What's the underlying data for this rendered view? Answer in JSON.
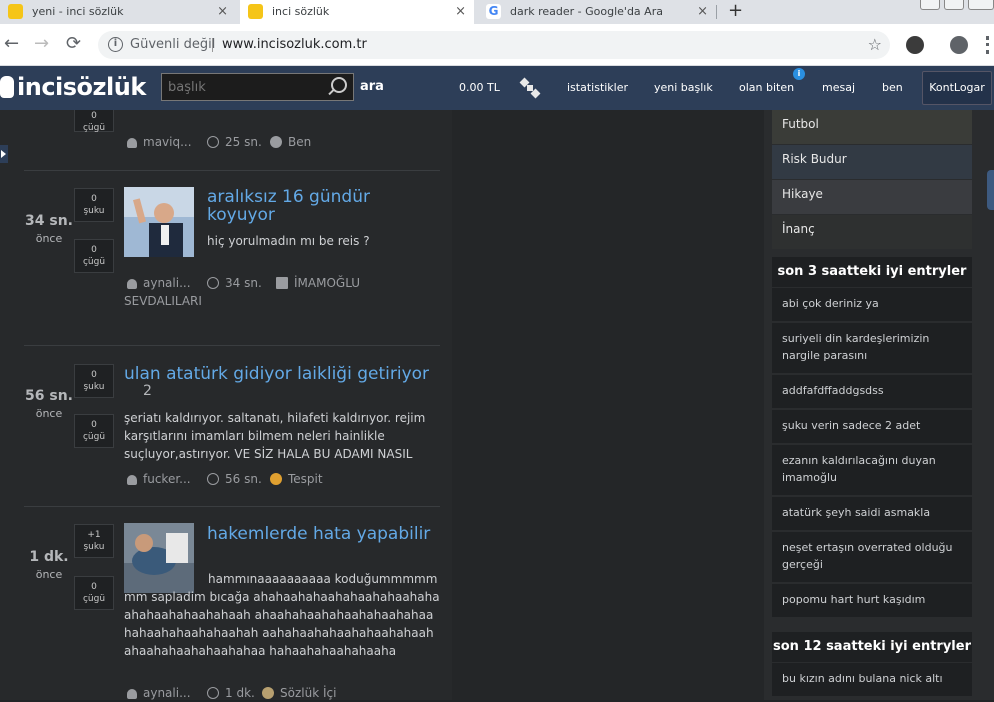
{
  "browser": {
    "tabs": [
      {
        "title": "yeni - inci sözlük",
        "close": "×"
      },
      {
        "title": "inci sözlük",
        "close": "×"
      },
      {
        "title": "dark reader - Google'da Ara",
        "close": "×"
      }
    ],
    "new_tab": "+",
    "nav": {
      "back": "←",
      "forward": "→",
      "reload": "⟳"
    },
    "security": "Güvenli değil",
    "url": "www.incisozluk.com.tr",
    "star": "☆",
    "info_glyph": "i"
  },
  "header": {
    "logo": "incisözlük",
    "search": {
      "placeholder": "başlık",
      "button": "ara"
    },
    "balance": "0.00 TL",
    "nav": {
      "stats": "istatistikler",
      "new_topic": "yeni başlık",
      "happening": "olan biten",
      "message": "mesaj",
      "me": "ben",
      "kontlogar": "KontLogar"
    },
    "notification": "i"
  },
  "entries": [
    {
      "vote_down_label": "0\nçügü",
      "user": "maviq...",
      "time": "25 sn.",
      "category": "Ben"
    },
    {
      "time_big": "34 sn.",
      "time_small": "önce",
      "vote_up": {
        "count": "0",
        "label": "şuku"
      },
      "vote_down": {
        "count": "0",
        "label": "çügü"
      },
      "title": "aralıksız 16 gündür koyuyor",
      "text": "hiç yorulmadın mı be reis ?",
      "user": "aynali...",
      "meta_time": "34 sn.",
      "category": "İMAMOĞLU SEVDALILARI"
    },
    {
      "time_big": "56 sn.",
      "time_small": "önce",
      "vote_up": {
        "count": "0",
        "label": "şuku"
      },
      "vote_down": {
        "count": "0",
        "label": "çügü"
      },
      "title": "ulan atatürk gidiyor laikliği getiriyor",
      "unread": "2",
      "text": "şeriatı kaldırıyor. saltanatı, hilafeti kaldırıyor. rejim karşıtlarını imamları bilmem neleri hainlikle suçluyor,astırıyor. VE SİZ HALA BU ADAMI NASIL",
      "user": "fucker...",
      "meta_time": "56 sn.",
      "category": "Tespit"
    },
    {
      "time_big": "1 dk.",
      "time_small": "önce",
      "vote_up": {
        "count": "+1",
        "label": "şuku"
      },
      "vote_down": {
        "count": "0",
        "label": "çügü"
      },
      "title": "hakemlerde hata yapabilir",
      "text": "hammınaaaaaaaaaa koduğummmmmmm sapladim bıcağa ahahaahahaahahaahahaahahaahahaahahaahahaah ahaahahaahahaahahaahahaahahaahahaahahaahah aahahaahahaahahaahahaahahaahahaahahaahahaa hahaahahaahahaaha",
      "user": "aynali...",
      "meta_time": "1 dk.",
      "category": "Sözlük İçi"
    }
  ],
  "sidebar": {
    "categories": [
      "Futbol",
      "Risk Budur",
      "Hikaye",
      "İnanç"
    ],
    "section1_title": "son 3 saatteki iyi entryler",
    "section1_items": [
      "abi çok deriniz ya",
      "suriyeli din kardeşlerimizin nargile parasını",
      "addfafdffaddgsdss",
      "şuku verin sadece 2 adet",
      "ezanın kaldırılacağını duyan imamoğlu",
      "atatürk şeyh saidi asmakla",
      "neşet ertaşın overrated olduğu gerçeği",
      "popomu hart hurt kaşıdım"
    ],
    "section2_title": "son 12 saatteki iyi entryler",
    "section2_items": [
      "bu kızın adını bulana nick altı"
    ]
  },
  "colors": {
    "header_bg": "#2d3e58",
    "title_link": "#63a9e6",
    "page_bg": "#27292b"
  }
}
